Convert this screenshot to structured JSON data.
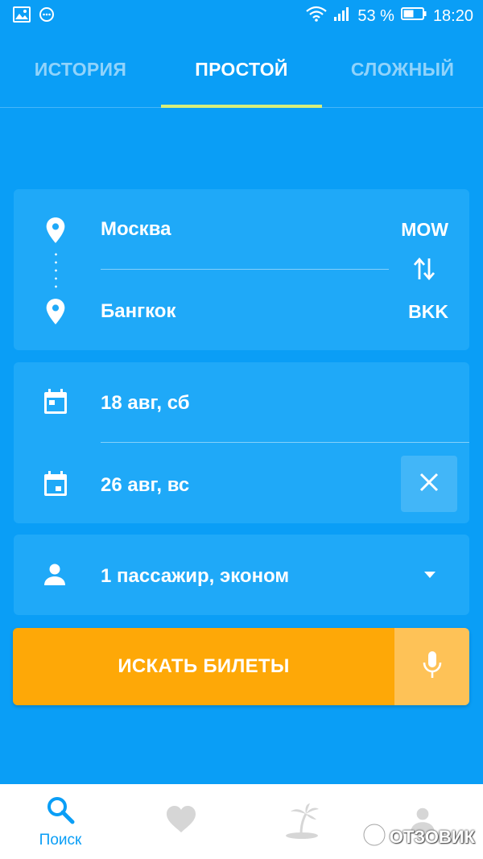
{
  "status_bar": {
    "battery_percent": "53 %",
    "time": "18:20"
  },
  "tabs": [
    {
      "label": "ИСТОРИЯ",
      "active": false
    },
    {
      "label": "ПРОСТОЙ",
      "active": true
    },
    {
      "label": "СЛОЖНЫЙ",
      "active": false
    }
  ],
  "route": {
    "origin": {
      "city": "Москва",
      "code": "MOW"
    },
    "destination": {
      "city": "Бангкок",
      "code": "BKK"
    }
  },
  "dates": {
    "depart": "18 авг, сб",
    "return": "26 авг, вс"
  },
  "passengers": {
    "label": "1 пассажир, эконом"
  },
  "search": {
    "button_label": "ИСКАТЬ БИЛЕТЫ"
  },
  "bottom_nav": {
    "search_label": "Поиск"
  },
  "watermark": "ОТЗОВИК",
  "colors": {
    "background": "#0a9ef6",
    "card": "#1fa9f8",
    "accent_orange": "#fea807",
    "tab_indicator": "#d7ee7a"
  }
}
